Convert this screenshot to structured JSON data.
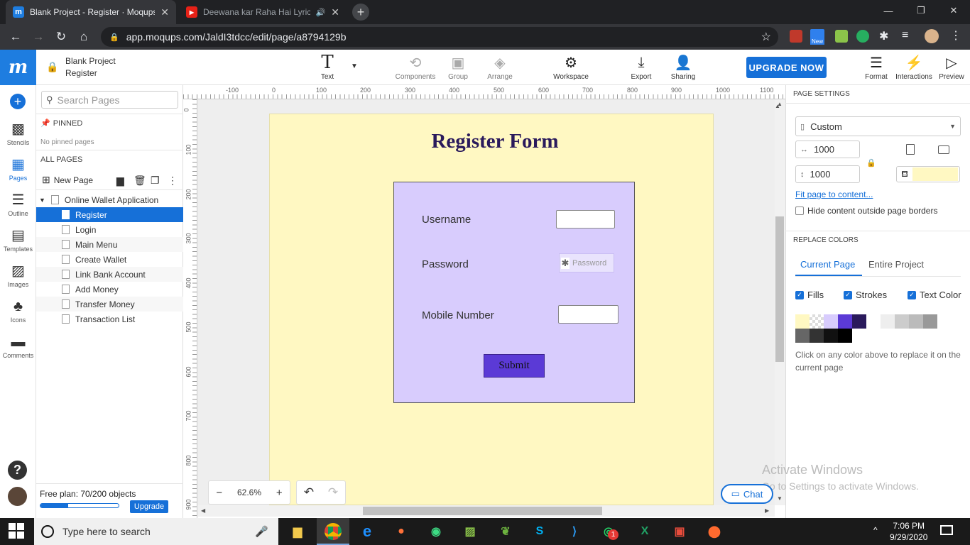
{
  "browser": {
    "tabs": [
      {
        "title": "Blank Project - Register · Moqups",
        "close": "✕"
      },
      {
        "title": "Deewana kar Raha Hai Lyrics",
        "close": "✕"
      }
    ],
    "new_tab": "+",
    "window_buttons": {
      "minimize": "—",
      "maximize": "❐",
      "close": "✕"
    },
    "url": "app.moqups.com/JaldI3tdcc/edit/page/a8794129b",
    "ext_new_badge": "New"
  },
  "app": {
    "logo": "m",
    "project_name": "Blank Project",
    "page_name": "Register",
    "toolbar": {
      "text": "Text",
      "components": "Components",
      "group": "Group",
      "arrange": "Arrange",
      "workspace": "Workspace",
      "export": "Export",
      "sharing": "Sharing",
      "upgrade": "UPGRADE NOW",
      "format": "Format",
      "interactions": "Interactions",
      "preview": "Preview"
    },
    "rail": {
      "stencils": "Stencils",
      "pages": "Pages",
      "outline": "Outline",
      "templates": "Templates",
      "images": "Images",
      "icons": "Icons",
      "comments": "Comments"
    },
    "pages_panel": {
      "search_placeholder": "Search Pages",
      "pinned_header": "PINNED",
      "no_pinned": "No pinned pages",
      "all_pages_header": "ALL PAGES",
      "new_page": "New Page",
      "folder": "Online Wallet Application",
      "pages": [
        "Register",
        "Login",
        "Main Menu",
        "Create Wallet",
        "Link Bank Account",
        "Add Money",
        "Transfer Money",
        "Transaction List"
      ],
      "selected": "Register",
      "plan_text": "Free plan: 70/200 objects",
      "plan_usage": 0.35,
      "plan_upgrade": "Upgrade"
    },
    "ruler": {
      "h_labels": [
        "-100",
        "0",
        "100",
        "200",
        "300",
        "400",
        "500",
        "600",
        "700",
        "800",
        "900",
        "1000",
        "1100"
      ],
      "v_labels": [
        "0",
        "100",
        "200",
        "300",
        "400",
        "500",
        "600",
        "700",
        "800",
        "900"
      ]
    },
    "canvas": {
      "page_color": "#fff8c2",
      "form_title": "Register Form",
      "form_color": "#d8ccfd",
      "username_label": "Username",
      "password_label": "Password",
      "password_placeholder": "Password",
      "mobile_label": "Mobile Number",
      "submit_label": "Submit",
      "zoom": "62.6%",
      "zoom_out": "−",
      "zoom_in": "+"
    },
    "right_panel": {
      "page_settings": "PAGE SETTINGS",
      "size_preset": "Custom",
      "width": "1000",
      "height": "1000",
      "fit_link": "Fit page to content...",
      "hide_outside": "Hide content outside page borders",
      "replace_colors": "REPLACE COLORS",
      "tab_current": "Current Page",
      "tab_entire": "Entire Project",
      "fills": "Fills",
      "strokes": "Strokes",
      "text_color": "Text Color",
      "swatches": [
        "#fff8c2",
        "#dddddd",
        "#d8ccfd",
        "#5b3ad6",
        "#2a1a5c",
        "#ffffff",
        "#eeeeee",
        "#cccccc",
        "#bbbbbb",
        "#999999",
        "#666666",
        "#333333",
        "#111111",
        "#000000"
      ],
      "hint": "Click on any color above to replace it on the current page"
    },
    "chat": "Chat"
  },
  "watermark": {
    "title": "Activate Windows",
    "subtitle": "Go to Settings to activate Windows."
  },
  "taskbar": {
    "search_placeholder": "Type here to search",
    "time": "7:06 PM",
    "date": "9/29/2020",
    "whatsapp_badge": "1"
  }
}
